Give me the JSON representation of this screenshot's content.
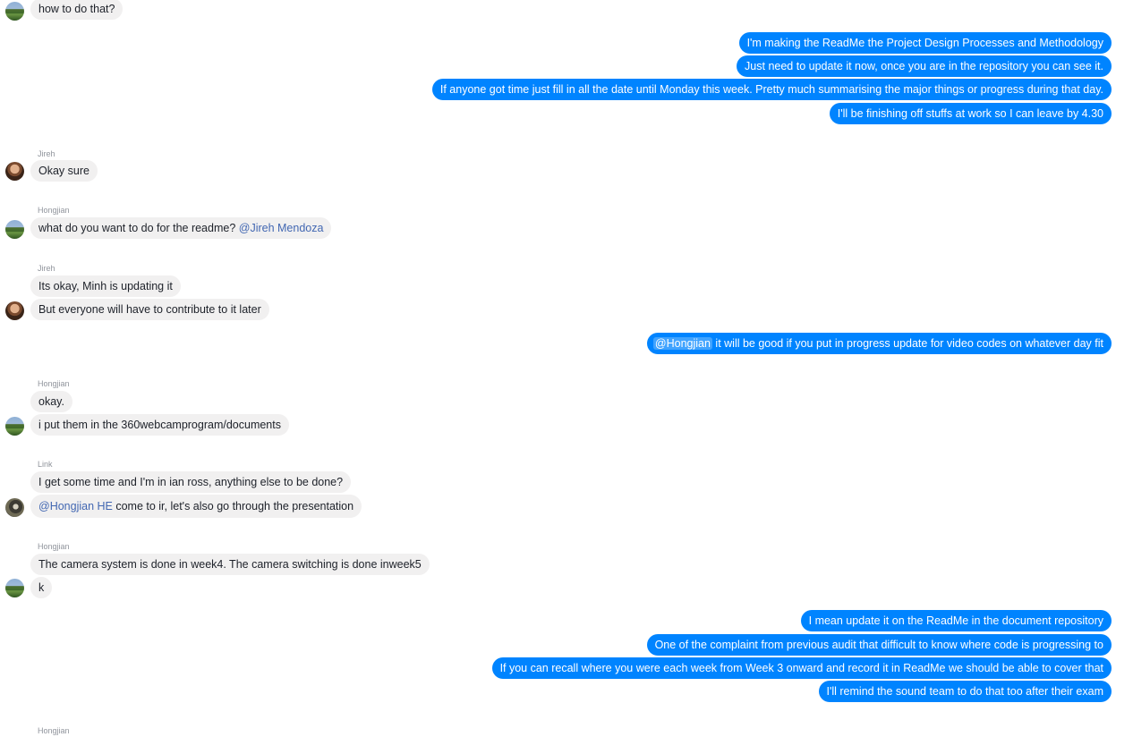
{
  "messages": {
    "m0": "how to do that?",
    "g1": [
      "I'm making the ReadMe the Project Design Processes and Methodology",
      "Just need to update it now, once you are in the repository you can see it.",
      "If anyone got time just fill in all the date until Monday this week. Pretty much summarising the major things or progress during that day.",
      "I'll be finishing off stuffs at work so I can leave by 4.30"
    ],
    "jireh1": {
      "sender": "Jireh",
      "text": "Okay sure"
    },
    "hong1": {
      "sender": "Hongjian",
      "text": "what do you want to do for the readme? ",
      "mention": "@Jireh Mendoza"
    },
    "jireh2": {
      "sender": "Jireh",
      "texts": [
        "Its okay, Minh is updating it",
        "But everyone will have to contribute to it later"
      ]
    },
    "out2": {
      "mention": "@Hongjian",
      "text": " it will be good if you put in progress update for video codes on whatever day fit"
    },
    "hong2": {
      "sender": "Hongjian",
      "texts": [
        "okay.",
        "i put them in the 360webcamprogram/documents"
      ]
    },
    "link1": {
      "sender": "Link",
      "text1": "I get some time and I'm in ian ross, anything else to be done?",
      "mention": "@Hongjian HE",
      "text2": " come to ir, let's also go through the presentation"
    },
    "hong3": {
      "sender": "Hongjian",
      "texts": [
        "The camera system is done in week4. The camera switching is done inweek5",
        "k"
      ]
    },
    "g3": [
      "I mean update it on the ReadMe in the document repository",
      "One of the complaint from previous audit that difficult to know where code is progressing to",
      "If you can recall where you were each week from Week 3 onward and record it in ReadMe we should be able to cover that",
      "I'll remind the sound team to do that too after their exam"
    ],
    "hong4": {
      "sender": "Hongjian"
    }
  }
}
